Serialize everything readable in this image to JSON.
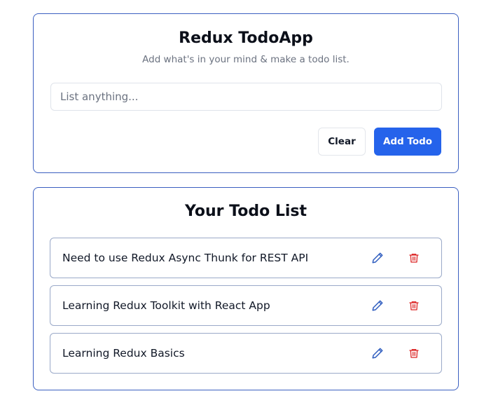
{
  "add_section": {
    "title": "Redux TodoApp",
    "subtitle": "Add what's in your mind & make a todo list.",
    "input_placeholder": "List anything...",
    "input_value": "",
    "clear_label": "Clear",
    "add_label": "Add Todo"
  },
  "list_section": {
    "title": "Your Todo List",
    "items": [
      {
        "text": "Need to use Redux Async Thunk for REST API"
      },
      {
        "text": "Learning Redux Toolkit with React App"
      },
      {
        "text": "Learning Redux Basics"
      }
    ]
  },
  "icons": {
    "edit": "pencil-icon",
    "delete": "trash-icon"
  },
  "colors": {
    "primary": "#2563eb",
    "card_border": "#3b5fc0",
    "edit_icon": "#2f5dbf",
    "delete_icon": "#dc2626",
    "subtitle": "#6b7280"
  }
}
